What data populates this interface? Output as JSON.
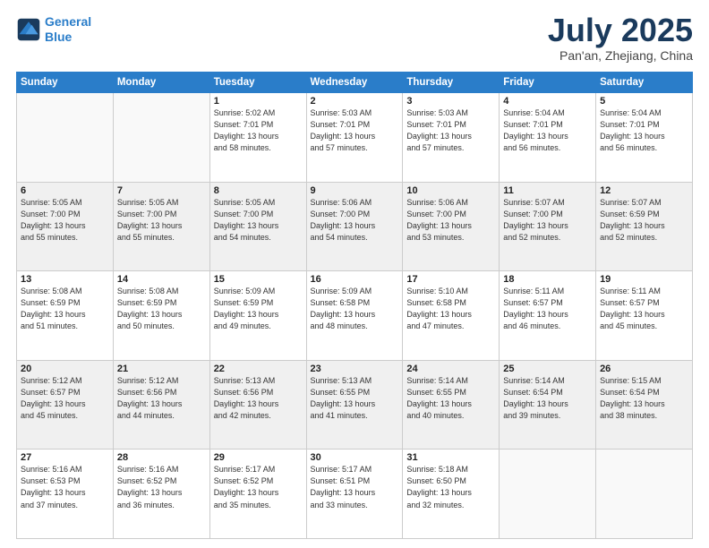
{
  "logo": {
    "line1": "General",
    "line2": "Blue"
  },
  "title": "July 2025",
  "location": "Pan'an, Zhejiang, China",
  "days_of_week": [
    "Sunday",
    "Monday",
    "Tuesday",
    "Wednesday",
    "Thursday",
    "Friday",
    "Saturday"
  ],
  "weeks": [
    [
      {
        "day": "",
        "info": ""
      },
      {
        "day": "",
        "info": ""
      },
      {
        "day": "1",
        "info": "Sunrise: 5:02 AM\nSunset: 7:01 PM\nDaylight: 13 hours\nand 58 minutes."
      },
      {
        "day": "2",
        "info": "Sunrise: 5:03 AM\nSunset: 7:01 PM\nDaylight: 13 hours\nand 57 minutes."
      },
      {
        "day": "3",
        "info": "Sunrise: 5:03 AM\nSunset: 7:01 PM\nDaylight: 13 hours\nand 57 minutes."
      },
      {
        "day": "4",
        "info": "Sunrise: 5:04 AM\nSunset: 7:01 PM\nDaylight: 13 hours\nand 56 minutes."
      },
      {
        "day": "5",
        "info": "Sunrise: 5:04 AM\nSunset: 7:01 PM\nDaylight: 13 hours\nand 56 minutes."
      }
    ],
    [
      {
        "day": "6",
        "info": "Sunrise: 5:05 AM\nSunset: 7:00 PM\nDaylight: 13 hours\nand 55 minutes."
      },
      {
        "day": "7",
        "info": "Sunrise: 5:05 AM\nSunset: 7:00 PM\nDaylight: 13 hours\nand 55 minutes."
      },
      {
        "day": "8",
        "info": "Sunrise: 5:05 AM\nSunset: 7:00 PM\nDaylight: 13 hours\nand 54 minutes."
      },
      {
        "day": "9",
        "info": "Sunrise: 5:06 AM\nSunset: 7:00 PM\nDaylight: 13 hours\nand 54 minutes."
      },
      {
        "day": "10",
        "info": "Sunrise: 5:06 AM\nSunset: 7:00 PM\nDaylight: 13 hours\nand 53 minutes."
      },
      {
        "day": "11",
        "info": "Sunrise: 5:07 AM\nSunset: 7:00 PM\nDaylight: 13 hours\nand 52 minutes."
      },
      {
        "day": "12",
        "info": "Sunrise: 5:07 AM\nSunset: 6:59 PM\nDaylight: 13 hours\nand 52 minutes."
      }
    ],
    [
      {
        "day": "13",
        "info": "Sunrise: 5:08 AM\nSunset: 6:59 PM\nDaylight: 13 hours\nand 51 minutes."
      },
      {
        "day": "14",
        "info": "Sunrise: 5:08 AM\nSunset: 6:59 PM\nDaylight: 13 hours\nand 50 minutes."
      },
      {
        "day": "15",
        "info": "Sunrise: 5:09 AM\nSunset: 6:59 PM\nDaylight: 13 hours\nand 49 minutes."
      },
      {
        "day": "16",
        "info": "Sunrise: 5:09 AM\nSunset: 6:58 PM\nDaylight: 13 hours\nand 48 minutes."
      },
      {
        "day": "17",
        "info": "Sunrise: 5:10 AM\nSunset: 6:58 PM\nDaylight: 13 hours\nand 47 minutes."
      },
      {
        "day": "18",
        "info": "Sunrise: 5:11 AM\nSunset: 6:57 PM\nDaylight: 13 hours\nand 46 minutes."
      },
      {
        "day": "19",
        "info": "Sunrise: 5:11 AM\nSunset: 6:57 PM\nDaylight: 13 hours\nand 45 minutes."
      }
    ],
    [
      {
        "day": "20",
        "info": "Sunrise: 5:12 AM\nSunset: 6:57 PM\nDaylight: 13 hours\nand 45 minutes."
      },
      {
        "day": "21",
        "info": "Sunrise: 5:12 AM\nSunset: 6:56 PM\nDaylight: 13 hours\nand 44 minutes."
      },
      {
        "day": "22",
        "info": "Sunrise: 5:13 AM\nSunset: 6:56 PM\nDaylight: 13 hours\nand 42 minutes."
      },
      {
        "day": "23",
        "info": "Sunrise: 5:13 AM\nSunset: 6:55 PM\nDaylight: 13 hours\nand 41 minutes."
      },
      {
        "day": "24",
        "info": "Sunrise: 5:14 AM\nSunset: 6:55 PM\nDaylight: 13 hours\nand 40 minutes."
      },
      {
        "day": "25",
        "info": "Sunrise: 5:14 AM\nSunset: 6:54 PM\nDaylight: 13 hours\nand 39 minutes."
      },
      {
        "day": "26",
        "info": "Sunrise: 5:15 AM\nSunset: 6:54 PM\nDaylight: 13 hours\nand 38 minutes."
      }
    ],
    [
      {
        "day": "27",
        "info": "Sunrise: 5:16 AM\nSunset: 6:53 PM\nDaylight: 13 hours\nand 37 minutes."
      },
      {
        "day": "28",
        "info": "Sunrise: 5:16 AM\nSunset: 6:52 PM\nDaylight: 13 hours\nand 36 minutes."
      },
      {
        "day": "29",
        "info": "Sunrise: 5:17 AM\nSunset: 6:52 PM\nDaylight: 13 hours\nand 35 minutes."
      },
      {
        "day": "30",
        "info": "Sunrise: 5:17 AM\nSunset: 6:51 PM\nDaylight: 13 hours\nand 33 minutes."
      },
      {
        "day": "31",
        "info": "Sunrise: 5:18 AM\nSunset: 6:50 PM\nDaylight: 13 hours\nand 32 minutes."
      },
      {
        "day": "",
        "info": ""
      },
      {
        "day": "",
        "info": ""
      }
    ]
  ]
}
